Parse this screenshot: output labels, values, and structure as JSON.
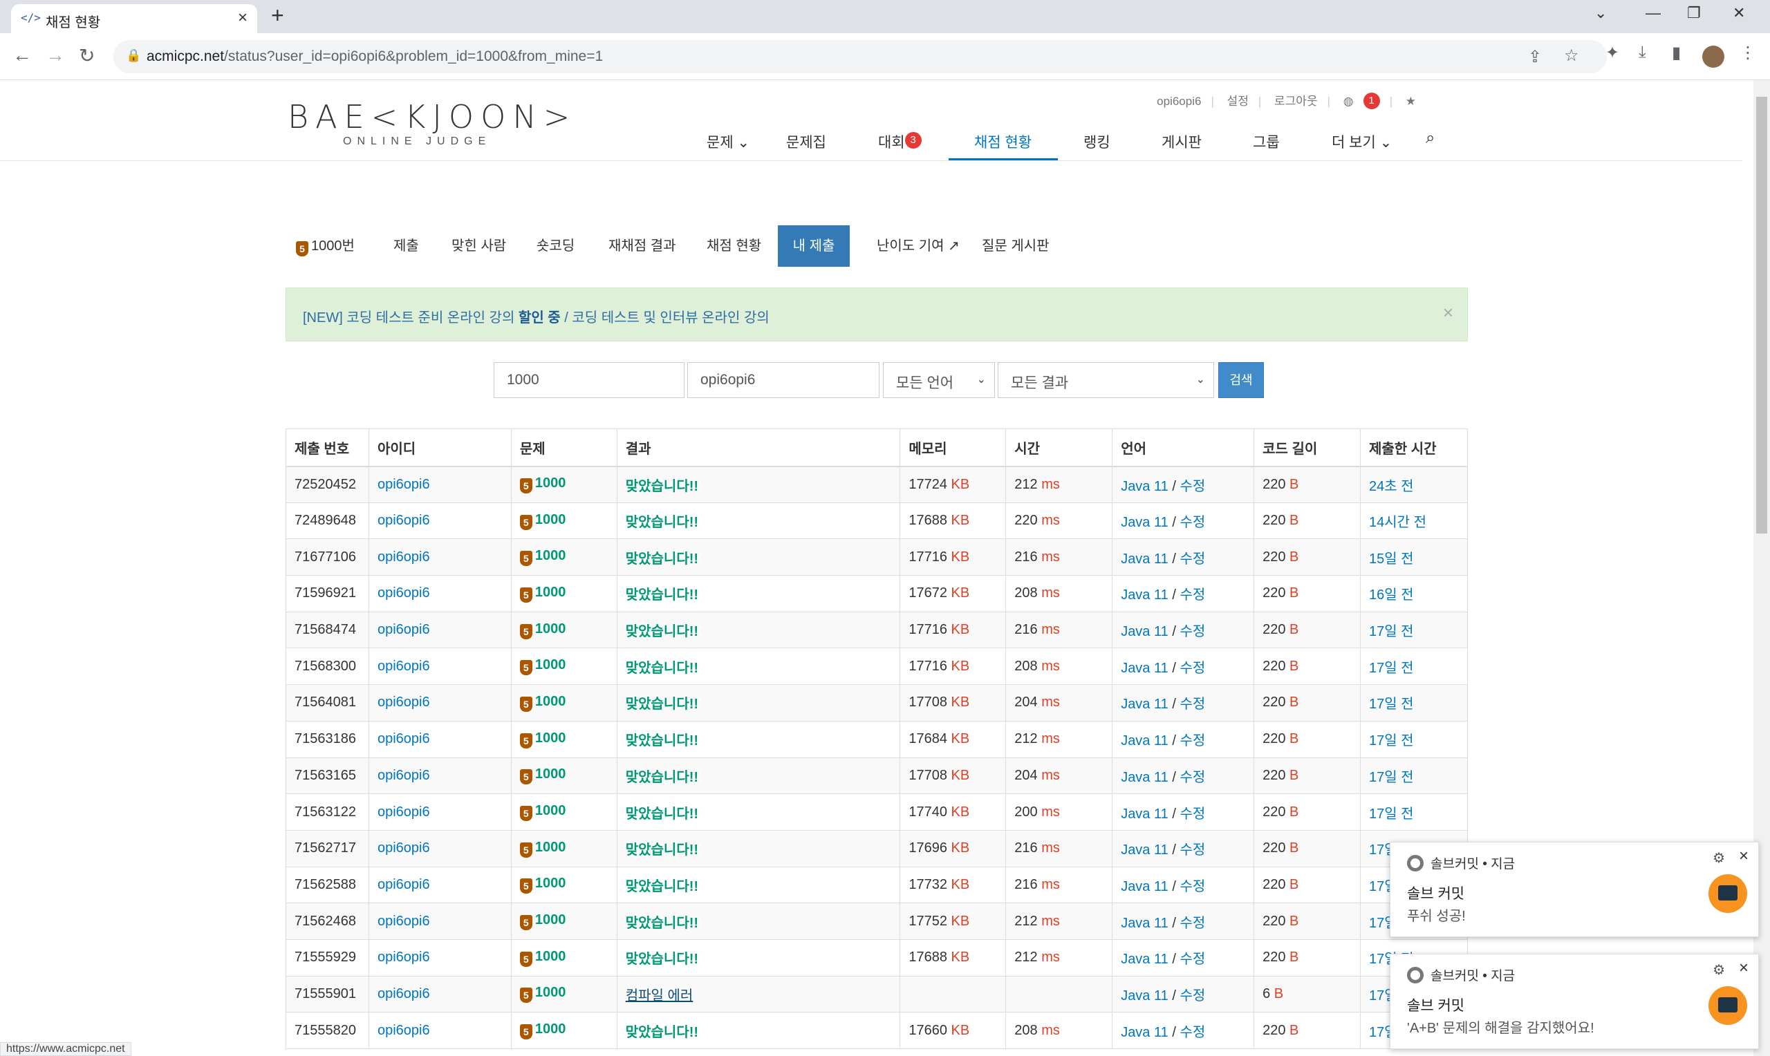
{
  "browser": {
    "tab_title": "채점 현황",
    "tab_favicon": "</>",
    "url_host": "acmicpc.net",
    "url_path": "/status?user_id=opi6opi6&problem_id=1000&from_mine=1",
    "status_url": "https://www.acmicpc.net"
  },
  "header": {
    "logo": "BAE<KJOON>",
    "logo_sub": "ONLINE JUDGE",
    "user": "opi6opi6",
    "settings": "설정",
    "logout": "로그아웃",
    "notif_count": "1",
    "nav": {
      "problems": "문제 ⌄",
      "workbooks": "문제집",
      "contests": "대회",
      "contests_badge": "3",
      "status": "채점 현황",
      "ranking": "랭킹",
      "board": "게시판",
      "groups": "그룹",
      "more": "더 보기 ⌄"
    }
  },
  "subtabs": {
    "problem": "1000번",
    "submit": "제출",
    "solvers": "맞힌 사람",
    "shortcoding": "숏코딩",
    "rejudge": "재채점 결과",
    "status": "채점 현황",
    "mine": "내 제출",
    "difficulty": "난이도 기여",
    "qna": "질문 게시판"
  },
  "alert": {
    "prefix": "[NEW] 코딩 테스트 준비 온라인 강의 ",
    "bold": "할인 중",
    "suffix": " / 코딩 테스트 및 인터뷰 온라인 강의"
  },
  "search": {
    "problem_id": "1000",
    "user_id": "opi6opi6",
    "language": "모든 언어",
    "result": "모든 결과",
    "button": "검색"
  },
  "table": {
    "headers": [
      "제출 번호",
      "아이디",
      "문제",
      "결과",
      "메모리",
      "시간",
      "언어",
      "코드 길이",
      "제출한 시간"
    ],
    "rows": [
      {
        "id": "72520452",
        "user": "opi6opi6",
        "problem": "1000",
        "result": "맞았습니다!!",
        "memory": "17724",
        "time": "212",
        "lang": "Java 11",
        "edit": "수정",
        "len": "220",
        "when": "24초 전"
      },
      {
        "id": "72489648",
        "user": "opi6opi6",
        "problem": "1000",
        "result": "맞았습니다!!",
        "memory": "17688",
        "time": "220",
        "lang": "Java 11",
        "edit": "수정",
        "len": "220",
        "when": "14시간 전"
      },
      {
        "id": "71677106",
        "user": "opi6opi6",
        "problem": "1000",
        "result": "맞았습니다!!",
        "memory": "17716",
        "time": "216",
        "lang": "Java 11",
        "edit": "수정",
        "len": "220",
        "when": "15일 전"
      },
      {
        "id": "71596921",
        "user": "opi6opi6",
        "problem": "1000",
        "result": "맞았습니다!!",
        "memory": "17672",
        "time": "208",
        "lang": "Java 11",
        "edit": "수정",
        "len": "220",
        "when": "16일 전"
      },
      {
        "id": "71568474",
        "user": "opi6opi6",
        "problem": "1000",
        "result": "맞았습니다!!",
        "memory": "17716",
        "time": "216",
        "lang": "Java 11",
        "edit": "수정",
        "len": "220",
        "when": "17일 전"
      },
      {
        "id": "71568300",
        "user": "opi6opi6",
        "problem": "1000",
        "result": "맞았습니다!!",
        "memory": "17716",
        "time": "208",
        "lang": "Java 11",
        "edit": "수정",
        "len": "220",
        "when": "17일 전"
      },
      {
        "id": "71564081",
        "user": "opi6opi6",
        "problem": "1000",
        "result": "맞았습니다!!",
        "memory": "17708",
        "time": "204",
        "lang": "Java 11",
        "edit": "수정",
        "len": "220",
        "when": "17일 전"
      },
      {
        "id": "71563186",
        "user": "opi6opi6",
        "problem": "1000",
        "result": "맞았습니다!!",
        "memory": "17684",
        "time": "212",
        "lang": "Java 11",
        "edit": "수정",
        "len": "220",
        "when": "17일 전"
      },
      {
        "id": "71563165",
        "user": "opi6opi6",
        "problem": "1000",
        "result": "맞았습니다!!",
        "memory": "17708",
        "time": "204",
        "lang": "Java 11",
        "edit": "수정",
        "len": "220",
        "when": "17일 전"
      },
      {
        "id": "71563122",
        "user": "opi6opi6",
        "problem": "1000",
        "result": "맞았습니다!!",
        "memory": "17740",
        "time": "200",
        "lang": "Java 11",
        "edit": "수정",
        "len": "220",
        "when": "17일 전"
      },
      {
        "id": "71562717",
        "user": "opi6opi6",
        "problem": "1000",
        "result": "맞았습니다!!",
        "memory": "17696",
        "time": "216",
        "lang": "Java 11",
        "edit": "수정",
        "len": "220",
        "when": "17일 전"
      },
      {
        "id": "71562588",
        "user": "opi6opi6",
        "problem": "1000",
        "result": "맞았습니다!!",
        "memory": "17732",
        "time": "216",
        "lang": "Java 11",
        "edit": "수정",
        "len": "220",
        "when": "17일 전"
      },
      {
        "id": "71562468",
        "user": "opi6opi6",
        "problem": "1000",
        "result": "맞았습니다!!",
        "memory": "17752",
        "time": "212",
        "lang": "Java 11",
        "edit": "수정",
        "len": "220",
        "when": "17일 전"
      },
      {
        "id": "71555929",
        "user": "opi6opi6",
        "problem": "1000",
        "result": "맞았습니다!!",
        "memory": "17688",
        "time": "212",
        "lang": "Java 11",
        "edit": "수정",
        "len": "220",
        "when": "17일 전"
      },
      {
        "id": "71555901",
        "user": "opi6opi6",
        "problem": "1000",
        "result": "컴파일 에러",
        "memory": "",
        "time": "",
        "lang": "Java 11",
        "edit": "수정",
        "len": "6",
        "when": "17일 전"
      },
      {
        "id": "71555820",
        "user": "opi6opi6",
        "problem": "1000",
        "result": "맞았습니다!!",
        "memory": "17660",
        "time": "208",
        "lang": "Java 11",
        "edit": "수정",
        "len": "220",
        "when": "17일 전"
      }
    ],
    "units": {
      "memory": "KB",
      "time": "ms",
      "len": "B"
    },
    "lang_sep": "/"
  },
  "notifications": [
    {
      "app": "솔브커밋",
      "when": "지금",
      "title": "솔브 커밋",
      "body": "푸쉬 성공!"
    },
    {
      "app": "솔브커밋",
      "when": "지금",
      "title": "솔브 커밋",
      "body": "'A+B' 문제의 해결을 감지했어요!"
    }
  ],
  "colors": {
    "accent": "#0076c0",
    "tab_active": "#337ab7",
    "success": "#009874",
    "unit_red": "#dd4124",
    "alert_bg": "#dff0d8",
    "tier_bronze": "#ad5600"
  }
}
